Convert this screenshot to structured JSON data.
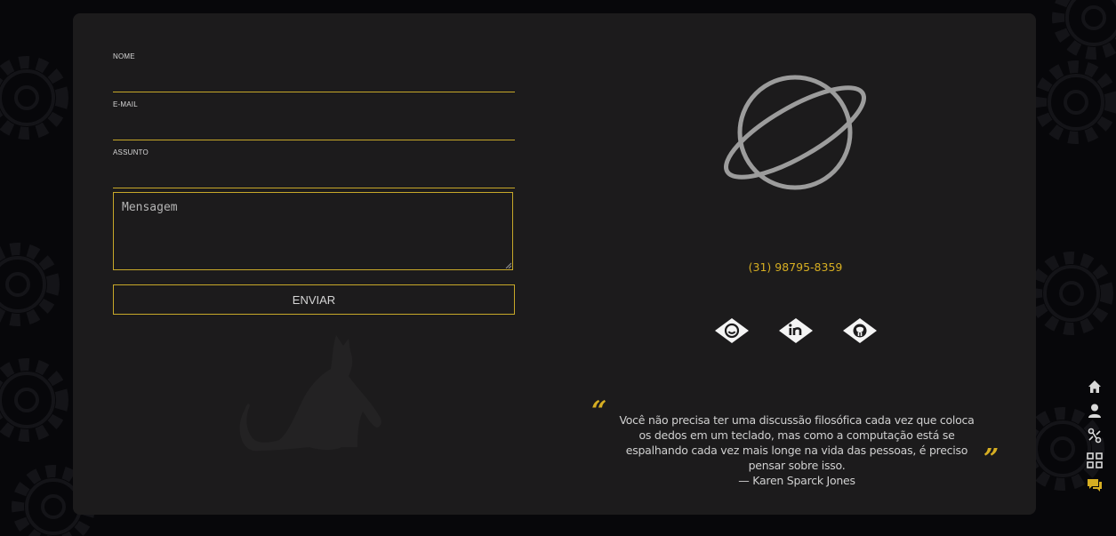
{
  "form": {
    "name_label": "NOME",
    "email_label": "E-MAIL",
    "subject_label": "ASSUNTO",
    "message_placeholder": "Mensagem",
    "submit_label": "ENVIAR"
  },
  "contact": {
    "phone": "(31) 98795-8359",
    "social": [
      {
        "icon": "skype-icon"
      },
      {
        "icon": "linkedin-icon"
      },
      {
        "icon": "github-icon"
      }
    ]
  },
  "quote": {
    "open_mark": "“",
    "text": "Você não precisa ter uma discussão filosófica cada vez que coloca os dedos em um teclado, mas como a computação está se espalhando cada vez mais longe na vida das pessoas, é preciso pensar sobre isso.",
    "author": "— Karen Sparck Jones",
    "close_mark": "”"
  },
  "side_nav": [
    {
      "icon": "home-icon",
      "active": false
    },
    {
      "icon": "user-icon",
      "active": false
    },
    {
      "icon": "skills-icon",
      "active": false
    },
    {
      "icon": "portfolio-grid-icon",
      "active": false
    },
    {
      "icon": "contact-chat-icon",
      "active": true
    }
  ],
  "colors": {
    "accent": "#d6ae22",
    "card": "#1c1b1c",
    "background": "#07070a"
  }
}
